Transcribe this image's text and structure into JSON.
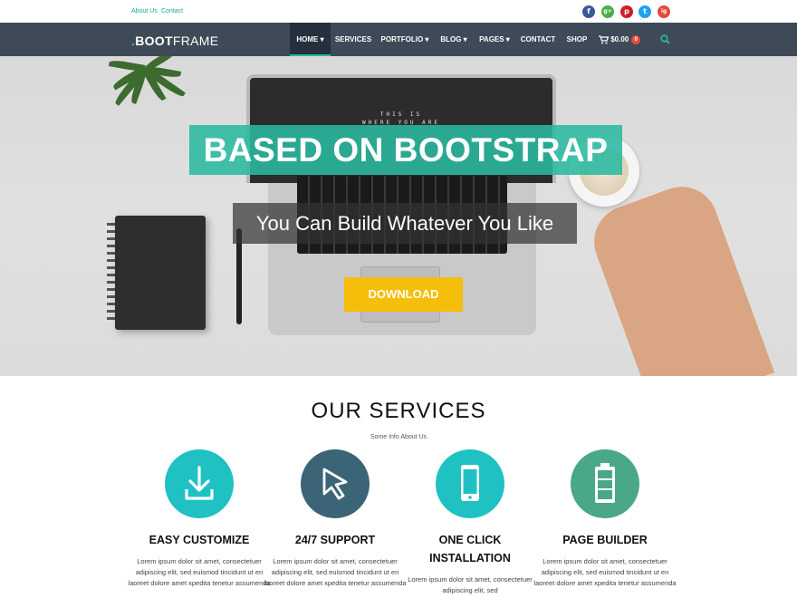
{
  "topbar": {
    "links": [
      "About Us",
      "Contact"
    ],
    "social": [
      {
        "icon": "facebook-icon",
        "glyph": "f",
        "color": "#3b5998"
      },
      {
        "icon": "google-plus-icon",
        "glyph": "g+",
        "color": "#4cae4c"
      },
      {
        "icon": "pinterest-icon",
        "glyph": "p",
        "color": "#cb2027"
      },
      {
        "icon": "twitter-icon",
        "glyph": "t",
        "color": "#1da1f2"
      },
      {
        "icon": "instagram-icon",
        "glyph": "ig",
        "color": "#e44a3a"
      }
    ]
  },
  "nav": {
    "logo_dot": ".",
    "logo_bold": "BOOT",
    "logo_rest": "FRAME",
    "items": [
      "HOME ▾",
      "SERVICES",
      "PORTFOLIO ▾",
      "BLOG ▾",
      "PAGES ▾",
      "CONTACT",
      "SHOP"
    ],
    "cart_total": "$0.00",
    "cart_count": "0",
    "accent": "#1fbf9f"
  },
  "hero": {
    "screen_text_1": "THIS IS",
    "screen_text_2": "WHERE YOU ARE",
    "headline": "BASED ON BOOTSTRAP",
    "subline": "You Can Build Whatever You Like",
    "button": "DOWNLOAD",
    "button_color": "#f5be0a"
  },
  "services": {
    "title": "OUR SERVICES",
    "subtitle": "Some Info About Us",
    "items": [
      {
        "icon": "download-icon",
        "color": "#1fc1c3",
        "title": "EASY CUSTOMIZE",
        "text": "Lorem ipsum dolor sit amet, consectetuer adipiscing elit, sed euismod tincidunt ut en laoreet dolore amet xpedita tenetur assumenda"
      },
      {
        "icon": "cursor-icon",
        "color": "#3b6577",
        "title": "24/7 SUPPORT",
        "text": "Lorem ipsum dolor sit amet, consectetuer adipiscing elit, sed euismod tincidunt ut en laoreet dolore amet xpedita tenetur assumenda"
      },
      {
        "icon": "mobile-phone-icon",
        "color": "#1fc1c3",
        "title": "ONE CLICK INSTALLATION",
        "text": "Lorem ipsum dolor sit amet, consectetuer adipiscing elit, sed"
      },
      {
        "icon": "battery-icon",
        "color": "#4aa888",
        "title": "PAGE BUILDER",
        "text": "Lorem ipsum dolor sit amet, consectetuer adipiscing elit, sed euismod tincidunt ut en laoreet dolore amet xpedita tenetur assumenda"
      }
    ]
  }
}
